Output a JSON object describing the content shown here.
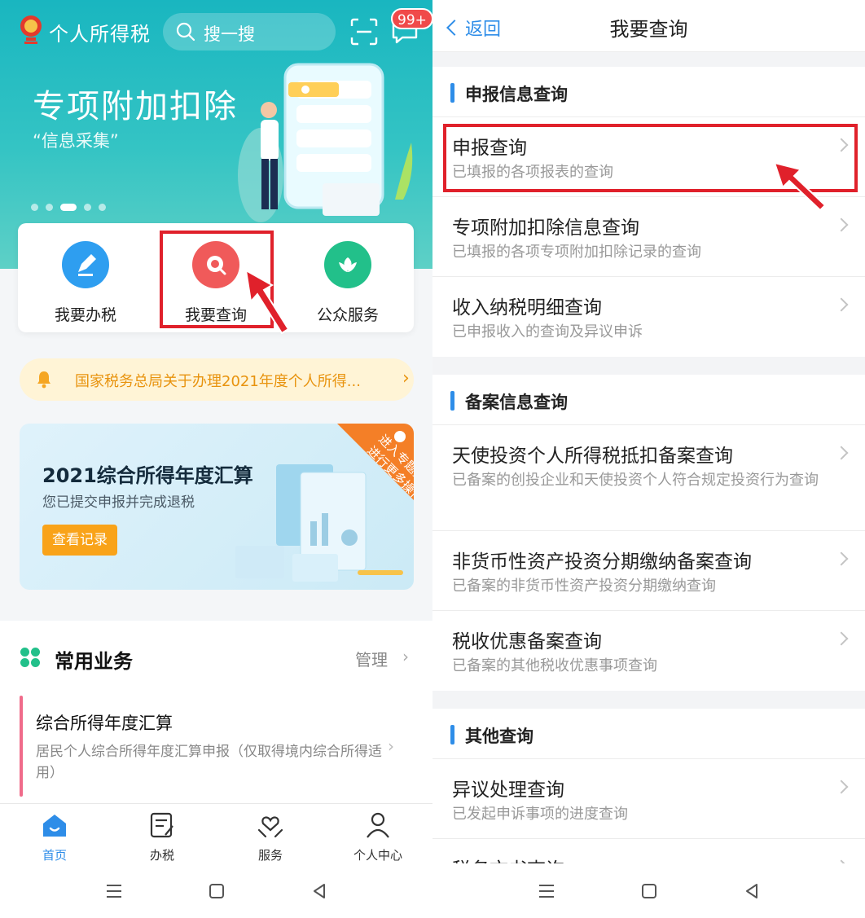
{
  "left": {
    "app_title": "个人所得税",
    "search_placeholder": "搜一搜",
    "message_badge": "99+",
    "banner": {
      "title": "专项附加扣除",
      "subtitle": "“信息采集”",
      "active_slide": 3,
      "slide_count": 5
    },
    "quick_actions": [
      {
        "label": "我要办税",
        "icon": "pen-icon",
        "color": "#2e9ef0"
      },
      {
        "label": "我要查询",
        "icon": "search-icon",
        "color": "#f05a5a",
        "highlighted": true
      },
      {
        "label": "公众服务",
        "icon": "flower-icon",
        "color": "#22c08a"
      }
    ],
    "notice": {
      "text": "国家税务总局关于办理2021年度个人所得..."
    },
    "annual_card": {
      "title": "2021综合所得年度汇算",
      "subtitle": "您已提交申报并完成退税",
      "button": "查看记录",
      "ribbon_line1": "进入专题页",
      "ribbon_line2": "进行更多操作"
    },
    "common_business": {
      "title": "常用业务",
      "manage": "管理",
      "items": [
        {
          "title": "综合所得年度汇算",
          "desc": "居民个人综合所得年度汇算申报（仅取得境内综合所得适用）"
        }
      ]
    },
    "tabs": [
      {
        "label": "首页",
        "icon": "home-icon",
        "active": true
      },
      {
        "label": "办税",
        "icon": "form-icon",
        "active": false
      },
      {
        "label": "服务",
        "icon": "service-icon",
        "active": false
      },
      {
        "label": "个人中心",
        "icon": "user-icon",
        "active": false
      }
    ]
  },
  "right": {
    "back_label": "返回",
    "title": "我要查询",
    "groups": [
      {
        "title": "申报信息查询",
        "items": [
          {
            "title": "申报查询",
            "desc": "已填报的各项报表的查询",
            "highlighted": true
          },
          {
            "title": "专项附加扣除信息查询",
            "desc": "已填报的各项专项附加扣除记录的查询"
          },
          {
            "title": "收入纳税明细查询",
            "desc": "已申报收入的查询及异议申诉"
          }
        ]
      },
      {
        "title": "备案信息查询",
        "items": [
          {
            "title": "天使投资个人所得税抵扣备案查询",
            "desc": "已备案的创投企业和天使投资个人符合规定投资行为查询"
          },
          {
            "title": "非货币性资产投资分期缴纳备案查询",
            "desc": "已备案的非货币性资产投资分期缴纳查询"
          },
          {
            "title": "税收优惠备案查询",
            "desc": "已备案的其他税收优惠事项查询"
          }
        ]
      },
      {
        "title": "其他查询",
        "items": [
          {
            "title": "异议处理查询",
            "desc": "已发起申诉事项的进度查询"
          },
          {
            "title": "税务文书查询",
            "desc": ""
          }
        ]
      }
    ]
  },
  "colors": {
    "accent": "#2e8de8",
    "highlight_red": "#e0212b",
    "notice_orange": "#e8930e",
    "button_orange": "#f9a319",
    "hero_teal": "#19b6c0"
  }
}
